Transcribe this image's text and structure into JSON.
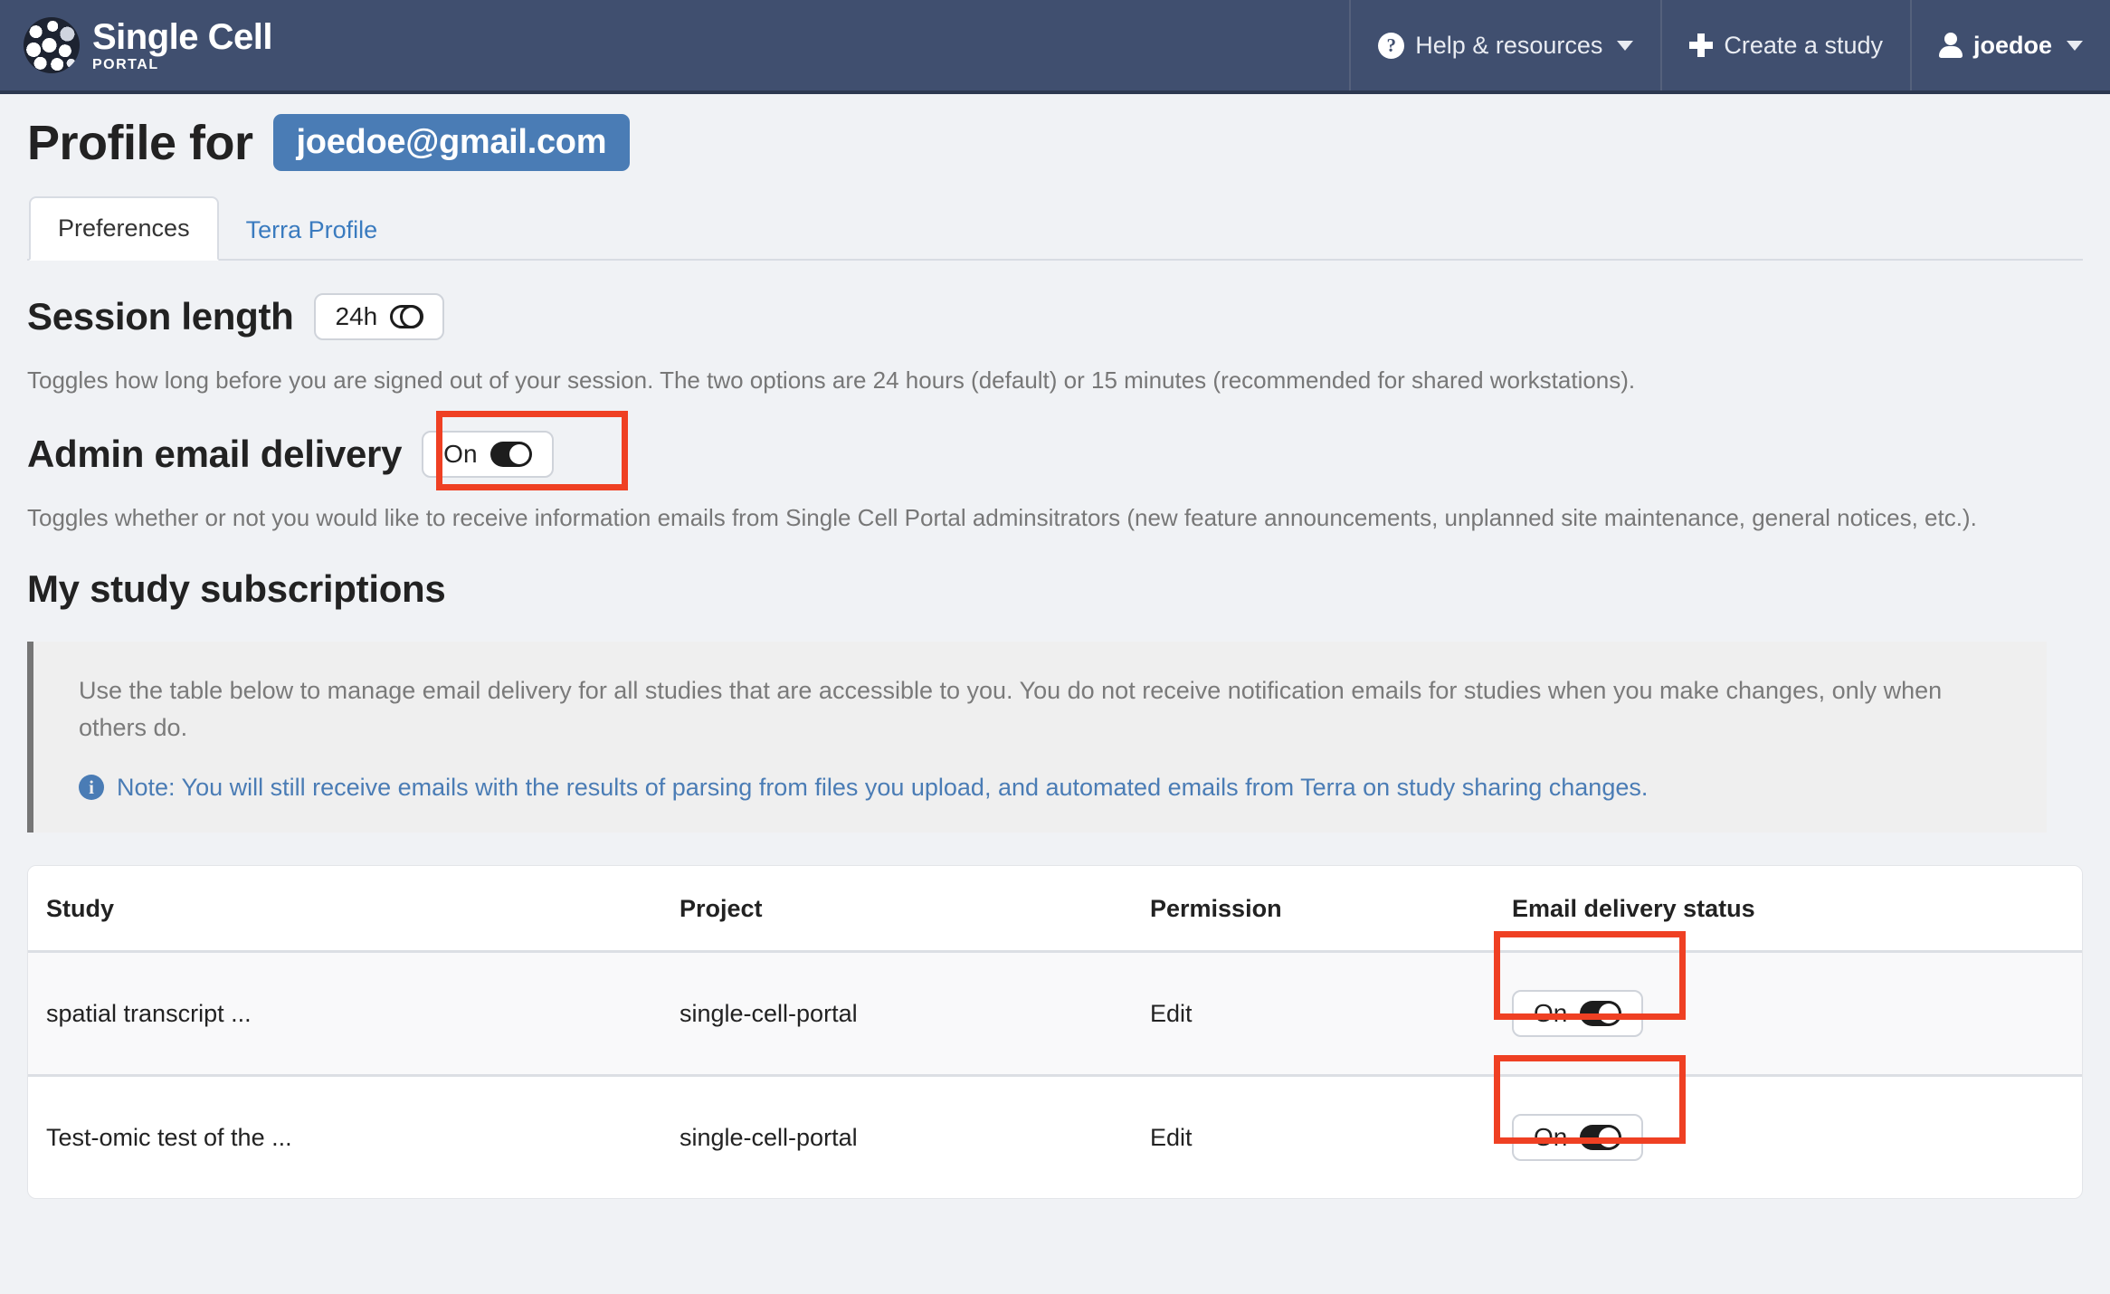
{
  "navbar": {
    "brand_name": "Single Cell",
    "brand_sub": "PORTAL",
    "help_label": "Help & resources",
    "create_study_label": "Create a study",
    "user_label": "joedoe"
  },
  "header": {
    "title": "Profile for",
    "email": "joedoe@gmail.com"
  },
  "tabs": [
    {
      "label": "Preferences",
      "active": true
    },
    {
      "label": "Terra Profile",
      "active": false
    }
  ],
  "session": {
    "heading": "Session length",
    "toggle_label": "24h",
    "description": "Toggles how long before you are signed out of your session. The two options are 24 hours (default) or 15 minutes (recommended for shared workstations)."
  },
  "admin_email": {
    "heading": "Admin email delivery",
    "toggle_label": "On",
    "description": "Toggles whether or not you would like to receive information emails from Single Cell Portal adminsitrators (new feature announcements, unplanned site maintenance, general notices, etc.)."
  },
  "subscriptions": {
    "heading": "My study subscriptions",
    "callout_text": "Use the table below to manage email delivery for all studies that are accessible to you. You do not receive notification emails for studies when you make changes, only when others do.",
    "note_text": "Note: You will still receive emails with the results of parsing from files you upload, and automated emails from Terra on study sharing changes.",
    "columns": [
      "Study",
      "Project",
      "Permission",
      "Email delivery status"
    ],
    "rows": [
      {
        "study": "spatial transcript ...",
        "project": "single-cell-portal",
        "permission": "Edit",
        "email_status": "On"
      },
      {
        "study": "Test-omic test of the ...",
        "project": "single-cell-portal",
        "permission": "Edit",
        "email_status": "On"
      }
    ]
  },
  "colors": {
    "navbar_bg": "#404f6f",
    "accent_blue": "#4a7cb5",
    "highlight_red": "#ef4023",
    "page_bg": "#f0f2f5"
  }
}
